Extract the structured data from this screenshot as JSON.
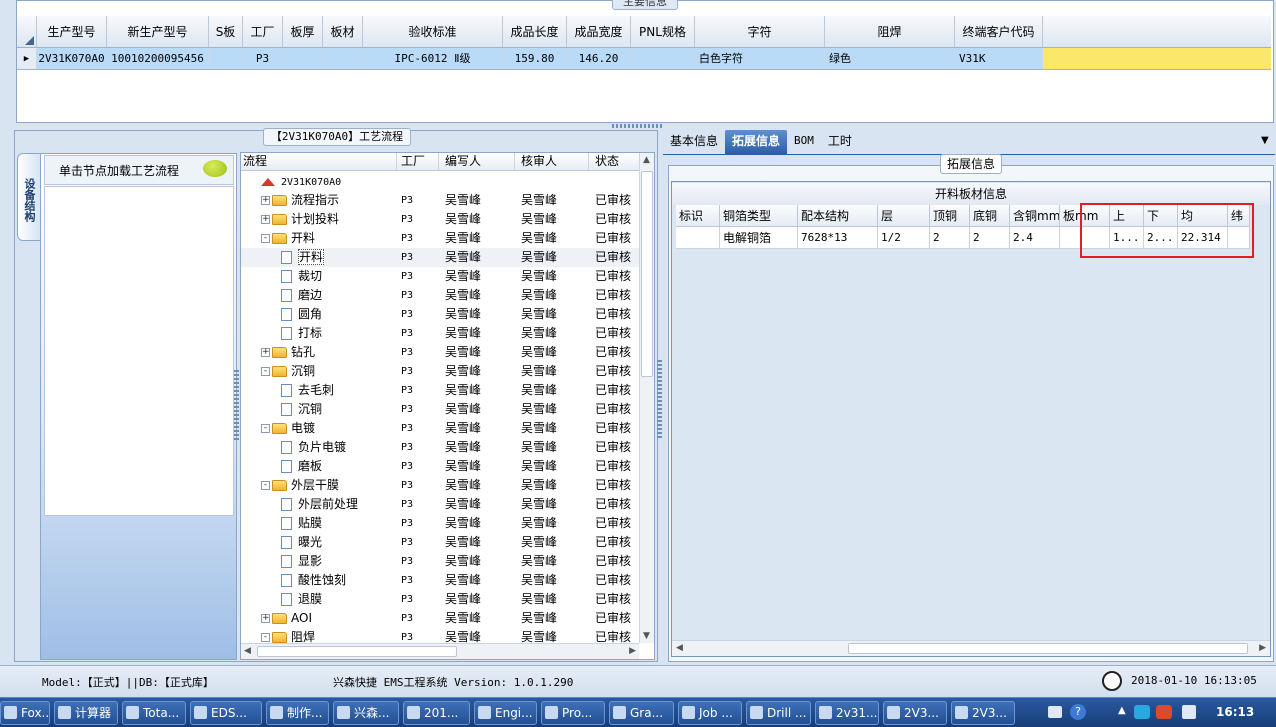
{
  "main_info": {
    "title": "主要信息",
    "columns": [
      "生产型号",
      "新生产型号",
      "S板",
      "工厂",
      "板厚",
      "板材",
      "验收标准",
      "成品长度",
      "成品宽度",
      "PNL规格",
      "字符",
      "阻焊",
      "终端客户代码"
    ],
    "row": [
      "2V31K070A0",
      "10010200095456",
      "",
      "P3",
      "",
      "",
      "IPC-6012 Ⅱ级",
      "159.80",
      "146.20",
      "",
      "白色字符",
      "绿色",
      "V31K"
    ]
  },
  "process": {
    "title": "【2V31K070A0】工艺流程",
    "side_tab_label": "设备结构",
    "side_header": "单击节点加载工艺流程",
    "columns": [
      "流程",
      "工厂",
      "编写人",
      "核审人",
      "状态"
    ],
    "rows": [
      {
        "name": "2V31K070A0",
        "level": 0,
        "type": "root",
        "factory": "",
        "writer": "",
        "reviewer": "",
        "status": ""
      },
      {
        "name": "流程指示",
        "level": 1,
        "type": "folder",
        "toggle": "+",
        "factory": "P3",
        "writer": "吴雪峰",
        "reviewer": "吴雪峰",
        "status": "已审核"
      },
      {
        "name": "计划投料",
        "level": 1,
        "type": "folder",
        "toggle": "+",
        "factory": "P3",
        "writer": "吴雪峰",
        "reviewer": "吴雪峰",
        "status": "已审核"
      },
      {
        "name": "开料",
        "level": 1,
        "type": "folder",
        "toggle": "-",
        "factory": "P3",
        "writer": "吴雪峰",
        "reviewer": "吴雪峰",
        "status": "已审核"
      },
      {
        "name": "开料",
        "level": 2,
        "type": "doc",
        "factory": "P3",
        "writer": "吴雪峰",
        "reviewer": "吴雪峰",
        "status": "已审核",
        "selected": true
      },
      {
        "name": "裁切",
        "level": 2,
        "type": "doc",
        "factory": "P3",
        "writer": "吴雪峰",
        "reviewer": "吴雪峰",
        "status": "已审核"
      },
      {
        "name": "磨边",
        "level": 2,
        "type": "doc",
        "factory": "P3",
        "writer": "吴雪峰",
        "reviewer": "吴雪峰",
        "status": "已审核"
      },
      {
        "name": "圆角",
        "level": 2,
        "type": "doc",
        "factory": "P3",
        "writer": "吴雪峰",
        "reviewer": "吴雪峰",
        "status": "已审核"
      },
      {
        "name": "打标",
        "level": 2,
        "type": "doc",
        "factory": "P3",
        "writer": "吴雪峰",
        "reviewer": "吴雪峰",
        "status": "已审核"
      },
      {
        "name": "钻孔",
        "level": 1,
        "type": "folder",
        "toggle": "+",
        "factory": "P3",
        "writer": "吴雪峰",
        "reviewer": "吴雪峰",
        "status": "已审核"
      },
      {
        "name": "沉铜",
        "level": 1,
        "type": "folder",
        "toggle": "-",
        "factory": "P3",
        "writer": "吴雪峰",
        "reviewer": "吴雪峰",
        "status": "已审核"
      },
      {
        "name": "去毛刺",
        "level": 2,
        "type": "doc",
        "factory": "P3",
        "writer": "吴雪峰",
        "reviewer": "吴雪峰",
        "status": "已审核"
      },
      {
        "name": "沉铜",
        "level": 2,
        "type": "doc",
        "factory": "P3",
        "writer": "吴雪峰",
        "reviewer": "吴雪峰",
        "status": "已审核"
      },
      {
        "name": "电镀",
        "level": 1,
        "type": "folder",
        "toggle": "-",
        "factory": "P3",
        "writer": "吴雪峰",
        "reviewer": "吴雪峰",
        "status": "已审核"
      },
      {
        "name": "负片电镀",
        "level": 2,
        "type": "doc",
        "factory": "P3",
        "writer": "吴雪峰",
        "reviewer": "吴雪峰",
        "status": "已审核"
      },
      {
        "name": "磨板",
        "level": 2,
        "type": "doc",
        "factory": "P3",
        "writer": "吴雪峰",
        "reviewer": "吴雪峰",
        "status": "已审核"
      },
      {
        "name": "外层干膜",
        "level": 1,
        "type": "folder",
        "toggle": "-",
        "factory": "P3",
        "writer": "吴雪峰",
        "reviewer": "吴雪峰",
        "status": "已审核"
      },
      {
        "name": "外层前处理",
        "level": 2,
        "type": "doc",
        "factory": "P3",
        "writer": "吴雪峰",
        "reviewer": "吴雪峰",
        "status": "已审核"
      },
      {
        "name": "贴膜",
        "level": 2,
        "type": "doc",
        "factory": "P3",
        "writer": "吴雪峰",
        "reviewer": "吴雪峰",
        "status": "已审核"
      },
      {
        "name": "曝光",
        "level": 2,
        "type": "doc",
        "factory": "P3",
        "writer": "吴雪峰",
        "reviewer": "吴雪峰",
        "status": "已审核"
      },
      {
        "name": "显影",
        "level": 2,
        "type": "doc",
        "factory": "P3",
        "writer": "吴雪峰",
        "reviewer": "吴雪峰",
        "status": "已审核"
      },
      {
        "name": "酸性蚀刻",
        "level": 2,
        "type": "doc",
        "factory": "P3",
        "writer": "吴雪峰",
        "reviewer": "吴雪峰",
        "status": "已审核"
      },
      {
        "name": "退膜",
        "level": 2,
        "type": "doc",
        "factory": "P3",
        "writer": "吴雪峰",
        "reviewer": "吴雪峰",
        "status": "已审核"
      },
      {
        "name": "AOI",
        "level": 1,
        "type": "folder",
        "toggle": "+",
        "factory": "P3",
        "writer": "吴雪峰",
        "reviewer": "吴雪峰",
        "status": "已审核"
      },
      {
        "name": "阻焊",
        "level": 1,
        "type": "folder",
        "toggle": "-",
        "factory": "P3",
        "writer": "吴雪峰",
        "reviewer": "吴雪峰",
        "status": "已审核"
      }
    ]
  },
  "right": {
    "tabs": [
      "基本信息",
      "拓展信息",
      "BOM",
      "工时"
    ],
    "active_tab": 1,
    "section_title": "拓展信息",
    "grid_caption": "开料板材信息",
    "columns": [
      "标识",
      "铜箔类型",
      "配本结构",
      "层",
      "顶铜",
      "底铜",
      "含铜mm",
      "板mm",
      "上",
      "下",
      "均",
      "纬"
    ],
    "row": [
      "",
      "电解铜箔",
      "7628*13",
      "1/2",
      "2",
      "2",
      "2.4",
      "",
      "1...",
      "2...",
      "22.314",
      ""
    ]
  },
  "status_bar": {
    "left": "Model:【正式】||DB:【正式库】",
    "center": "兴森快捷 EMS工程系统 Version: 1.0.1.290",
    "datetime": "2018-01-10 16:13:05"
  },
  "taskbar": {
    "items": [
      "Fox...",
      "计算器",
      "Tota...",
      "EDS...",
      "制作...",
      "兴森...",
      "201...",
      "Engi...",
      "Pro...",
      "Gra...",
      "Job ...",
      "Drill ...",
      "2v31...",
      "2V3...",
      "2V3..."
    ],
    "clock": "16:13"
  },
  "colors": {
    "selected_row": "#b9dbf8",
    "highlight_cell": "#fbe86a",
    "red_box": "#e02020",
    "active_tab": "#2c5ea8"
  }
}
